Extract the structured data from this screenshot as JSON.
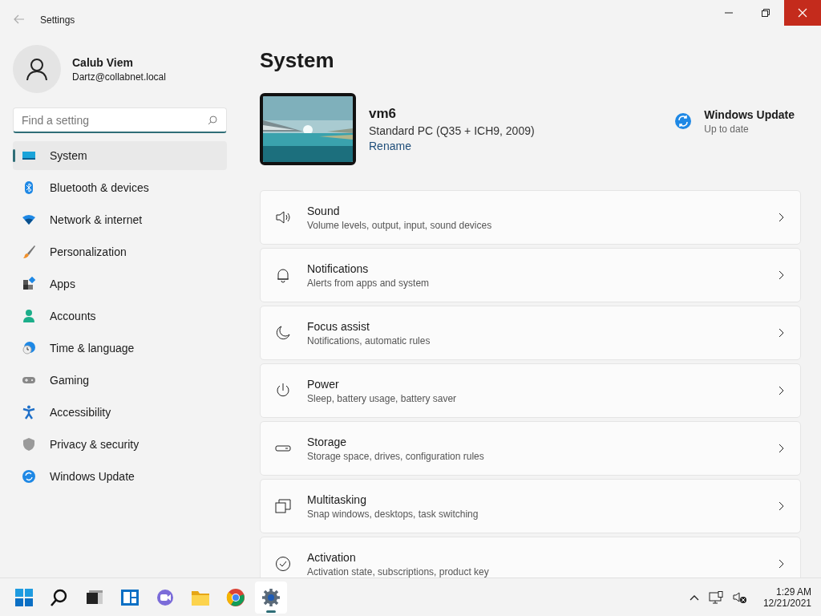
{
  "window": {
    "title": "Settings"
  },
  "user": {
    "name": "Calub Viem",
    "email": "Dartz@collabnet.local"
  },
  "search": {
    "placeholder": "Find a setting"
  },
  "sidebar": {
    "items": [
      {
        "label": "System",
        "selected": true
      },
      {
        "label": "Bluetooth & devices",
        "selected": false
      },
      {
        "label": "Network & internet",
        "selected": false
      },
      {
        "label": "Personalization",
        "selected": false
      },
      {
        "label": "Apps",
        "selected": false
      },
      {
        "label": "Accounts",
        "selected": false
      },
      {
        "label": "Time & language",
        "selected": false
      },
      {
        "label": "Gaming",
        "selected": false
      },
      {
        "label": "Accessibility",
        "selected": false
      },
      {
        "label": "Privacy & security",
        "selected": false
      },
      {
        "label": "Windows Update",
        "selected": false
      }
    ]
  },
  "page": {
    "title": "System"
  },
  "device": {
    "name": "vm6",
    "model": "Standard PC (Q35 + ICH9, 2009)",
    "rename": "Rename"
  },
  "update": {
    "title": "Windows Update",
    "status": "Up to date"
  },
  "cards": [
    {
      "title": "Sound",
      "subtitle": "Volume levels, output, input, sound devices"
    },
    {
      "title": "Notifications",
      "subtitle": "Alerts from apps and system"
    },
    {
      "title": "Focus assist",
      "subtitle": "Notifications, automatic rules"
    },
    {
      "title": "Power",
      "subtitle": "Sleep, battery usage, battery saver"
    },
    {
      "title": "Storage",
      "subtitle": "Storage space, drives, configuration rules"
    },
    {
      "title": "Multitasking",
      "subtitle": "Snap windows, desktops, task switching"
    },
    {
      "title": "Activation",
      "subtitle": "Activation state, subscriptions, product key"
    }
  ],
  "taskbar": {
    "apps": [
      {
        "selected": false
      },
      {
        "selected": false
      },
      {
        "selected": false
      },
      {
        "selected": false
      },
      {
        "selected": false
      },
      {
        "selected": false
      },
      {
        "selected": false
      },
      {
        "selected": true
      }
    ],
    "time": "1:29 AM",
    "date": "12/21/2021"
  }
}
